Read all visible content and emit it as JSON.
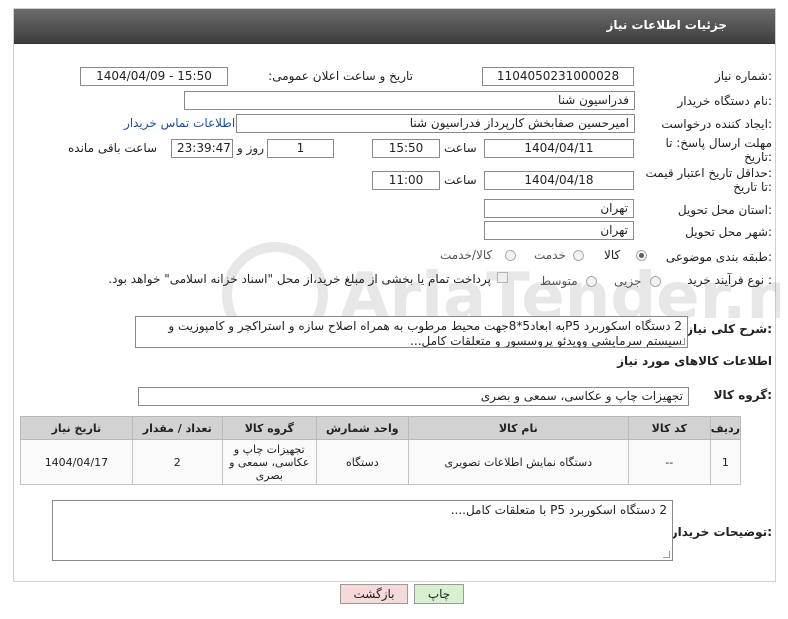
{
  "header": {
    "title": "جزئیات اطلاعات نیاز"
  },
  "form": {
    "need_number_label": "شماره نیاز:",
    "need_number": "1104050231000028",
    "announce_label": "تاریخ و ساعت اعلان عمومی:",
    "announce_value": "1404/04/09 - 15:50",
    "buyer_label": "نام دستگاه خریدار:",
    "buyer_value": "فدراسیون شنا",
    "requester_label": "ایجاد کننده درخواست:",
    "requester_value": "امیرحسین صفابخش کارپرداز فدراسیون شنا",
    "contact_link": "اطلاعات تماس خریدار",
    "deadline_label_1": "مهلت ارسال پاسخ: تا",
    "deadline_label_2": "تاریخ:",
    "deadline_date": "1404/04/11",
    "time_label": "ساعت",
    "deadline_time": "15:50",
    "days_value": "1",
    "days_label": "روز و",
    "remaining_value": "23:39:47",
    "remaining_label": "ساعت باقی مانده",
    "validity_label_1": "حداقل تاریخ اعتبار قیمت:",
    "validity_label_2": "تا تاریخ:",
    "validity_date": "1404/04/18",
    "validity_time_label": "ساعت",
    "validity_time": "11:00",
    "province_label": "استان محل تحویل:",
    "province_value": "تهران",
    "city_label": "شهر محل تحویل:",
    "city_value": "تهران",
    "category_label": "طبقه بندی موضوعی:",
    "category_options": [
      "کالا",
      "خدمت",
      "کالا/خدمت"
    ],
    "process_label": "نوع فرآیند خرید :",
    "process_options": [
      "جزیی",
      "متوسط"
    ],
    "payment_note": "پرداخت تمام یا بخشی از مبلغ خرید،از محل \"اسناد خزانه اسلامی\" خواهد بود.",
    "description_label": "شرح کلی نیاز:",
    "description_value": "2 دستگاه اسکوربرد P5به ابعاد5*8جهت محیط مرطوب به همراه اصلاح سازه و استراکچر و کامپوزیت و سیستم سرمایشی وویدئو پروسسور و متعلقات کامل..."
  },
  "goods": {
    "section_title": "اطلاعات کالاهای مورد نیاز",
    "group_label": "گروه کالا:",
    "group_value": "تجهیزات چاپ و عکاسی، سمعی و بصری",
    "columns": [
      "ردیف",
      "کد کالا",
      "نام کالا",
      "واحد شمارش",
      "گروه کالا",
      "تعداد / مقدار",
      "تاریخ نیاز"
    ],
    "rows": [
      {
        "row": "1",
        "code": "--",
        "name": "دستگاه نمایش اطلاعات تصویری",
        "unit": "دستگاه",
        "group": "تجهیزات چاپ و عکاسی، سمعی و بصری",
        "qty": "2",
        "date": "1404/04/17"
      }
    ]
  },
  "buyer_notes": {
    "label": "توضیحات خریدار:",
    "value": "2 دستگاه اسکوربرد P5 با متعلقات کامل...."
  },
  "buttons": {
    "print": "چاپ",
    "back": "بازگشت"
  },
  "watermark": {
    "text": "AriaTender.neT"
  },
  "colors": {
    "header": "#4a4a4a",
    "link": "#1b4f9c",
    "print_button": "#d8f0d0",
    "back_button": "#f6d9d9",
    "table_header": "#d2d2d2"
  }
}
